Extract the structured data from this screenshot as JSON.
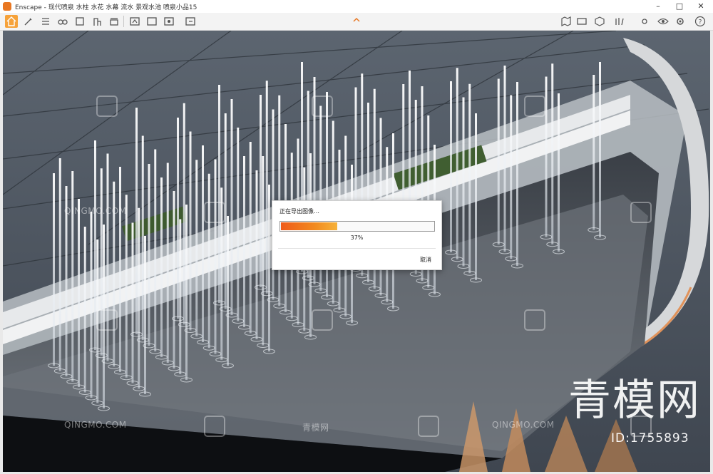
{
  "window": {
    "title": "Enscape - 现代喷泉 水柱 水花 水幕 流水 景观水池 喷泉小品15"
  },
  "dialog": {
    "message": "正在导出图像…",
    "progress": 0.37,
    "progress_label": "37%",
    "cancel_label": "取消"
  },
  "watermarks": {
    "site": "QINGMO.COM",
    "site_cn": "青模网",
    "brand": "青模网",
    "id_label": "ID:1755893"
  },
  "icons": [
    "home-icon",
    "brush-icon",
    "list-icon",
    "binoculars-icon",
    "book-icon",
    "building-icon",
    "clapper-icon",
    "export-icon",
    "settings-export-icon",
    "capture-icon",
    "batch-export-icon",
    "map-icon",
    "panorama-icon",
    "cube-icon",
    "library-icon",
    "sun-icon",
    "eye-icon",
    "gear-icon",
    "help-icon"
  ],
  "colors": {
    "accent": "#f6a23a",
    "progress": "#f28a1f"
  }
}
